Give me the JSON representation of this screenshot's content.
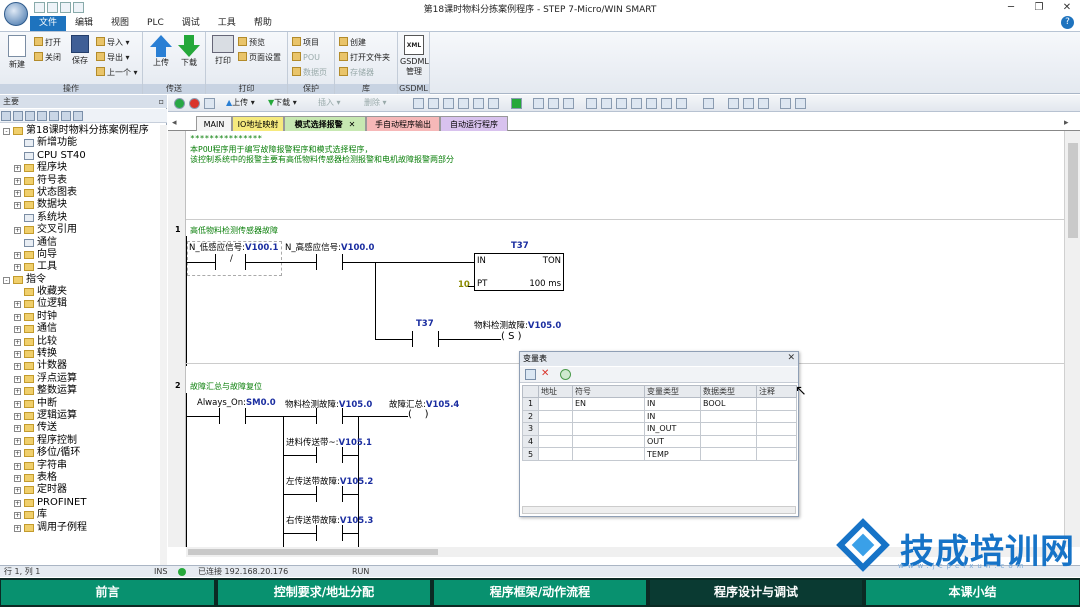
{
  "window": {
    "title": "第18课时物料分拣案例程序 - STEP 7-Micro/WIN SMART"
  },
  "menu": [
    "文件",
    "编辑",
    "视图",
    "PLC",
    "调试",
    "工具",
    "帮助"
  ],
  "ribbon": {
    "groups": [
      "操作",
      "传送",
      "打印",
      "保护",
      "库",
      "GSDML"
    ],
    "new": "新建",
    "open": "打开",
    "close": "关闭",
    "save": "保存",
    "import": "导入",
    "export": "导出",
    "prev": "上一个",
    "upload": "上传",
    "download": "下载",
    "print": "打印",
    "preview": "预览",
    "page_setup": "页面设置",
    "project": "项目",
    "pou": "POU",
    "data_page": "数据页",
    "create": "创建",
    "open_folder": "打开文件夹",
    "storage": "存储器",
    "gsdml": "GSDML",
    "gsdml_mgr": "管理",
    "xml": "XML"
  },
  "left_panel": {
    "header": "主要",
    "tree": [
      {
        "label": "第18课时物料分拣案例程序",
        "level": 0,
        "exp": "-",
        "kind": "proj"
      },
      {
        "label": "新增功能",
        "level": 1,
        "exp": "",
        "kind": "doc"
      },
      {
        "label": "CPU ST40",
        "level": 1,
        "exp": "",
        "kind": "doc"
      },
      {
        "label": "程序块",
        "level": 1,
        "exp": "+",
        "kind": "folder"
      },
      {
        "label": "符号表",
        "level": 1,
        "exp": "+",
        "kind": "folder"
      },
      {
        "label": "状态图表",
        "level": 1,
        "exp": "+",
        "kind": "folder"
      },
      {
        "label": "数据块",
        "level": 1,
        "exp": "+",
        "kind": "folder"
      },
      {
        "label": "系统块",
        "level": 1,
        "exp": "",
        "kind": "doc"
      },
      {
        "label": "交叉引用",
        "level": 1,
        "exp": "+",
        "kind": "folder"
      },
      {
        "label": "通信",
        "level": 1,
        "exp": "",
        "kind": "doc"
      },
      {
        "label": "向导",
        "level": 1,
        "exp": "+",
        "kind": "folder"
      },
      {
        "label": "工具",
        "level": 1,
        "exp": "+",
        "kind": "folder"
      },
      {
        "label": "指令",
        "level": 0,
        "exp": "-",
        "kind": "folder"
      },
      {
        "label": "收藏夹",
        "level": 1,
        "exp": "",
        "kind": "folder"
      },
      {
        "label": "位逻辑",
        "level": 1,
        "exp": "+",
        "kind": "folder"
      },
      {
        "label": "时钟",
        "level": 1,
        "exp": "+",
        "kind": "folder"
      },
      {
        "label": "通信",
        "level": 1,
        "exp": "+",
        "kind": "folder"
      },
      {
        "label": "比较",
        "level": 1,
        "exp": "+",
        "kind": "folder"
      },
      {
        "label": "转换",
        "level": 1,
        "exp": "+",
        "kind": "folder"
      },
      {
        "label": "计数器",
        "level": 1,
        "exp": "+",
        "kind": "folder"
      },
      {
        "label": "浮点运算",
        "level": 1,
        "exp": "+",
        "kind": "folder"
      },
      {
        "label": "整数运算",
        "level": 1,
        "exp": "+",
        "kind": "folder"
      },
      {
        "label": "中断",
        "level": 1,
        "exp": "+",
        "kind": "folder"
      },
      {
        "label": "逻辑运算",
        "level": 1,
        "exp": "+",
        "kind": "folder"
      },
      {
        "label": "传送",
        "level": 1,
        "exp": "+",
        "kind": "folder"
      },
      {
        "label": "程序控制",
        "level": 1,
        "exp": "+",
        "kind": "folder"
      },
      {
        "label": "移位/循环",
        "level": 1,
        "exp": "+",
        "kind": "folder"
      },
      {
        "label": "字符串",
        "level": 1,
        "exp": "+",
        "kind": "folder"
      },
      {
        "label": "表格",
        "level": 1,
        "exp": "+",
        "kind": "folder"
      },
      {
        "label": "定时器",
        "level": 1,
        "exp": "+",
        "kind": "folder"
      },
      {
        "label": "PROFINET",
        "level": 1,
        "exp": "+",
        "kind": "folder"
      },
      {
        "label": "库",
        "level": 1,
        "exp": "+",
        "kind": "folder"
      },
      {
        "label": "调用子例程",
        "level": 1,
        "exp": "+",
        "kind": "folder"
      }
    ]
  },
  "toolbar2": {
    "upload": "上传",
    "download": "下载",
    "insert": "插入",
    "delete": "删除"
  },
  "tabs": [
    "MAIN",
    "IO地址映射",
    "模式选择报警",
    "手自动程序输出",
    "自动运行程序"
  ],
  "comment": {
    "stars": "***************",
    "line1": "本POU程序用于编写故障报警程序和模式选择程序，",
    "line2": "该控制系统中的报警主要有高低物料传感器检测报警和电机故障报警两部分"
  },
  "network1": {
    "num": "1",
    "title": "高低物料检测传感器故障",
    "c1_name": "N_低感应信号:",
    "c1_addr": "V100.1",
    "c2_name": "N_高感应信号:",
    "c2_addr": "V100.0",
    "not_sym": "/",
    "timer": "T37",
    "box_in": "IN",
    "box_type": "TON",
    "box_pt": "PT",
    "pt_val": "10",
    "box_base": "100 ms",
    "c3_name": "T37",
    "coil_name": "物料检测故障:",
    "coil_addr": "V105.0",
    "coil_type": "S"
  },
  "network2": {
    "num": "2",
    "title": "故障汇总与故障复位",
    "c1_name": "Always_On:",
    "c1_addr": "SM0.0",
    "c2_name": "物料检测故障:",
    "c2_addr": "V105.0",
    "coil_name": "故障汇总:",
    "coil_addr": "V105.4",
    "p1_name": "进料传送带~:",
    "p1_addr": "V105.1",
    "p2_name": "左传送带故障:",
    "p2_addr": "V105.2",
    "p3_name": "右传送带故障:",
    "p3_addr": "V105.3"
  },
  "var_table": {
    "title": "变量表",
    "headers": [
      "",
      "地址",
      "符号",
      "变量类型",
      "数据类型",
      "注释"
    ],
    "rows": [
      [
        "1",
        "",
        "EN",
        "IN",
        "BOOL",
        ""
      ],
      [
        "2",
        "",
        "",
        "IN",
        "",
        ""
      ],
      [
        "3",
        "",
        "",
        "IN_OUT",
        "",
        ""
      ],
      [
        "4",
        "",
        "",
        "OUT",
        "",
        ""
      ],
      [
        "5",
        "",
        "",
        "TEMP",
        "",
        ""
      ]
    ]
  },
  "status": {
    "pos": "行 1, 列 1",
    "ins": "INS",
    "conn": "已连接 192.168.20.176",
    "mode": "RUN"
  },
  "brand": {
    "name": "技成培训网",
    "url": "www.jcpeixun.com"
  },
  "bottom_nav": [
    "前言",
    "控制要求/地址分配",
    "程序框架/动作流程",
    "程序设计与调试",
    "本课小结"
  ],
  "colors": {
    "accent": "#1e73be",
    "nav": "#08916f",
    "nav_active": "#0a3a32",
    "address": "#1a2da0",
    "comment": "#0a7f0a"
  }
}
